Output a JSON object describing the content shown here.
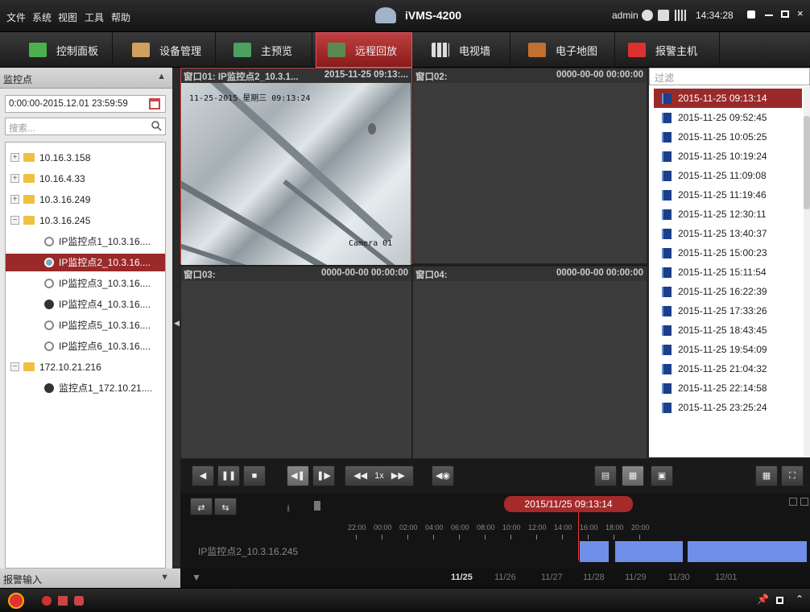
{
  "menu": [
    "文件",
    "系统",
    "视图",
    "工具",
    "帮助"
  ],
  "app_title": "iVMS-4200",
  "user": "admin",
  "clock": "14:34:28",
  "tabs": [
    {
      "label": "控制面板",
      "color": "#4caf50"
    },
    {
      "label": "设备管理",
      "color": "#d0a060"
    },
    {
      "label": "主预览",
      "color": "#4ca060"
    },
    {
      "label": "远程回放",
      "color": "#d05050"
    },
    {
      "label": "电视墙",
      "color": "#bbbbbb"
    },
    {
      "label": "电子地图",
      "color": "#c07030"
    },
    {
      "label": "报警主机",
      "color": "#dd3030"
    }
  ],
  "left": {
    "header": "监控点",
    "time_range": "0:00:00-2015.12.01 23:59:59",
    "search_placeholder": "搜索...",
    "tree": [
      {
        "label": "10.16.3.158",
        "type": "folder",
        "expand": "+"
      },
      {
        "label": "10.16.4.33",
        "type": "folder",
        "expand": "+"
      },
      {
        "label": "10.3.16.249",
        "type": "folder",
        "expand": "+"
      },
      {
        "label": "10.3.16.245",
        "type": "folder",
        "expand": "−"
      },
      {
        "label": "IP监控点1_10.3.16....",
        "type": "cam-off"
      },
      {
        "label": "IP监控点2_10.3.16....",
        "type": "cam-sel",
        "selected": true
      },
      {
        "label": "IP监控点3_10.3.16....",
        "type": "cam-off"
      },
      {
        "label": "IP监控点4_10.3.16....",
        "type": "cam-on"
      },
      {
        "label": "IP监控点5_10.3.16....",
        "type": "cam-off"
      },
      {
        "label": "IP监控点6_10.3.16....",
        "type": "cam-off"
      },
      {
        "label": "172.10.21.216",
        "type": "folder",
        "expand": "−"
      },
      {
        "label": "监控点1_172.10.21....",
        "type": "cam-on"
      }
    ],
    "alarm_header": "报警输入"
  },
  "windows": [
    {
      "title": "窗口01: IP监控点2_10.3.1...",
      "ts": "2015-11-25 09:13:..."
    },
    {
      "title": "窗口02:",
      "ts": "0000-00-00 00:00:00"
    },
    {
      "title": "窗口03:",
      "ts": "0000-00-00 00:00:00"
    },
    {
      "title": "窗口04:",
      "ts": "0000-00-00 00:00:00"
    }
  ],
  "osd": {
    "top": "11-25-2015 星期三 09:13:24",
    "bottom": "Camera 01"
  },
  "records": {
    "filter_placeholder": "过滤",
    "items": [
      "2015-11-25 09:13:14",
      "2015-11-25 09:52:45",
      "2015-11-25 10:05:25",
      "2015-11-25 10:19:24",
      "2015-11-25 11:09:08",
      "2015-11-25 11:19:46",
      "2015-11-25 12:30:11",
      "2015-11-25 13:40:37",
      "2015-11-25 15:00:23",
      "2015-11-25 15:11:54",
      "2015-11-25 16:22:39",
      "2015-11-25 17:33:26",
      "2015-11-25 18:43:45",
      "2015-11-25 19:54:09",
      "2015-11-25 21:04:32",
      "2015-11-25 22:14:58",
      "2015-11-25 23:25:24"
    ]
  },
  "controls": {
    "speed": "1x"
  },
  "timeline": {
    "date": "2015/11/25 09:13:14",
    "hours": [
      "22:00",
      "00:00",
      "02:00",
      "04:00",
      "06:00",
      "08:00",
      "10:00",
      "12:00",
      "14:00",
      "16:00",
      "18:00",
      "20:00"
    ],
    "camera": "IP监控点2_10.3.16.245"
  },
  "days": [
    "11/25",
    "11/26",
    "11/27",
    "11/28",
    "11/29",
    "11/30",
    "12/01"
  ]
}
